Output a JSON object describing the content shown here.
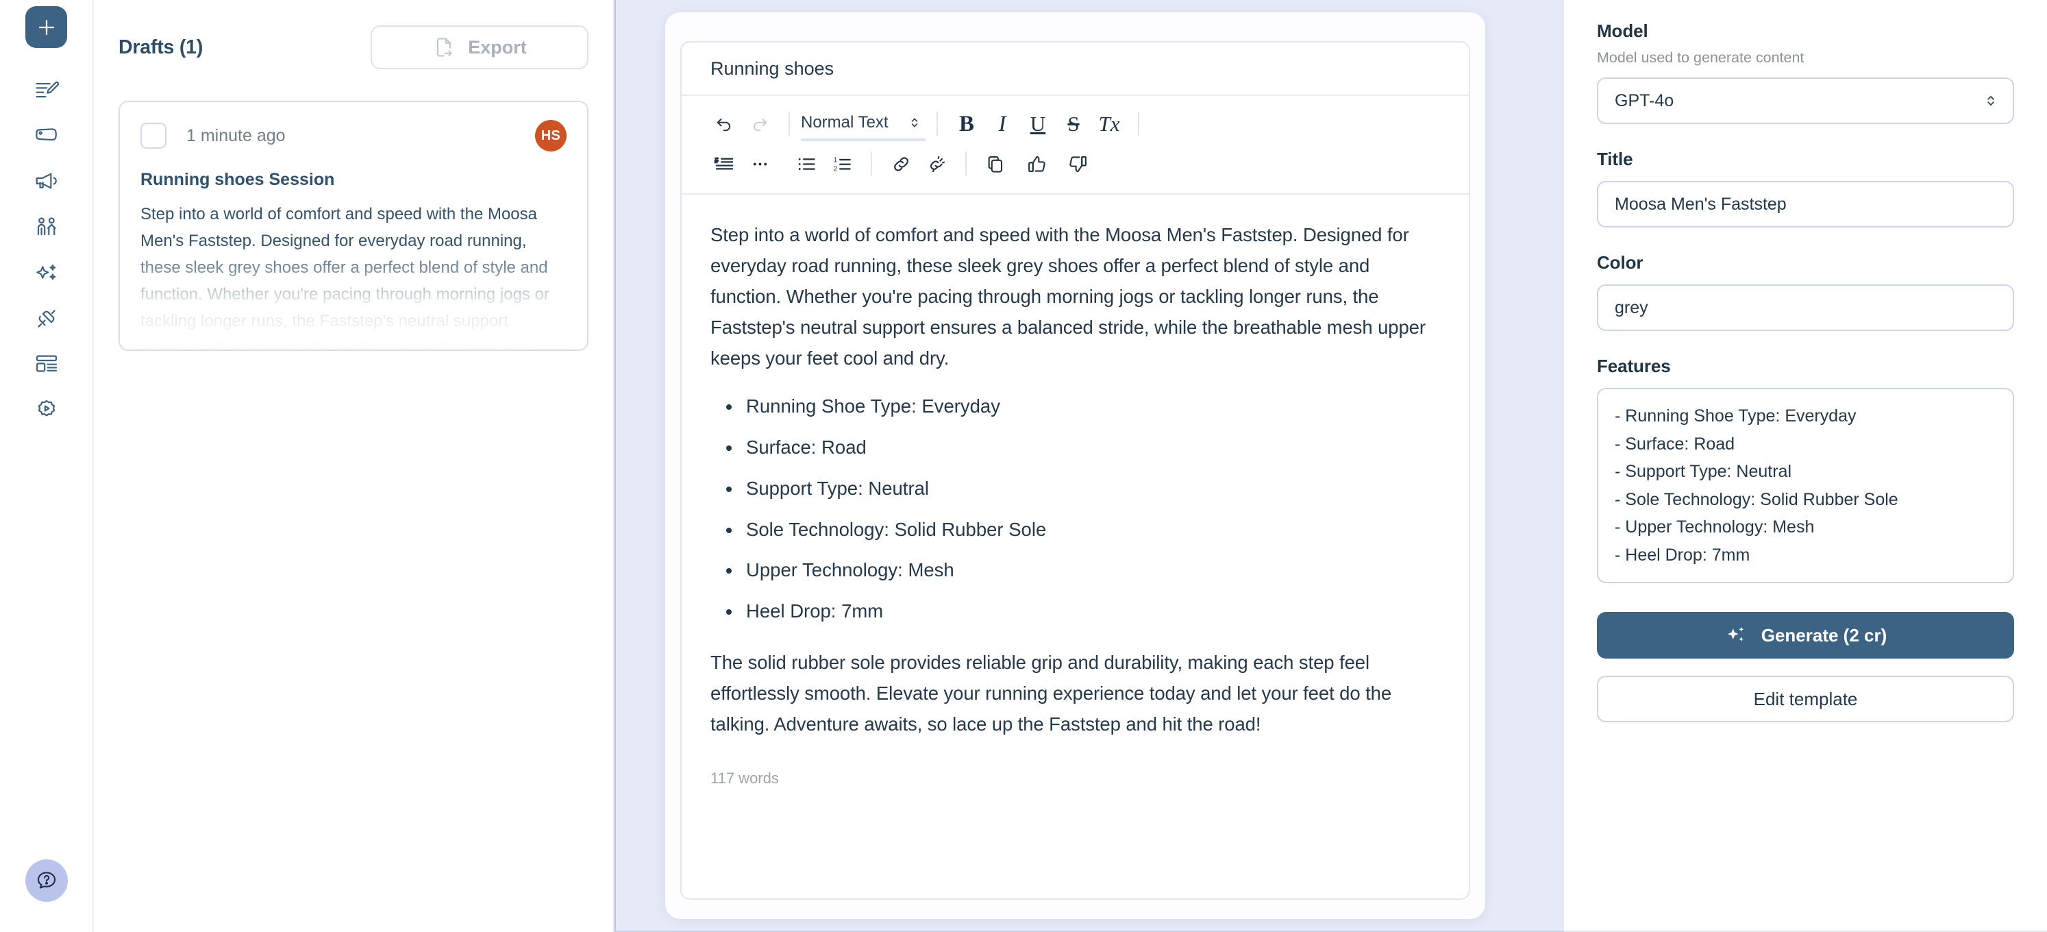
{
  "rail": {
    "add_button": "new",
    "items": [
      {
        "icon": "document-edit-icon",
        "name": "sidebar-item-drafts"
      },
      {
        "icon": "tag-icon",
        "name": "sidebar-item-tags"
      },
      {
        "icon": "megaphone-icon",
        "name": "sidebar-item-campaigns"
      },
      {
        "icon": "people-icon",
        "name": "sidebar-item-audience"
      },
      {
        "icon": "sparkles-icon",
        "name": "sidebar-item-ai"
      },
      {
        "icon": "plug-connect-icon",
        "name": "sidebar-item-integrations"
      },
      {
        "icon": "layout-icon",
        "name": "sidebar-item-templates"
      },
      {
        "icon": "badge-play-icon",
        "name": "sidebar-item-tutorials"
      }
    ],
    "help_icon": "question-bubble-icon"
  },
  "drafts": {
    "title": "Drafts (1)",
    "export_label": "Export",
    "export_icon": "file-export-icon",
    "card": {
      "timestamp": "1 minute ago",
      "avatar_initials": "HS",
      "session_name": "Running shoes Session",
      "preview": "Step into a world of comfort and speed with the Moosa Men's Faststep. Designed for everyday road running, these sleek grey shoes offer a perfect blend of style and function. Whether you're pacing through morning jogs or tackling longer runs, the Faststep's neutral support ensures a balanced stride, while the breathable mesh upper keeps your feet cool and dry. - Running Shoe"
    }
  },
  "editor": {
    "doc_title": "Running shoes",
    "toolbar": {
      "undo_icon": "undo-icon",
      "redo_icon": "redo-icon",
      "style_select": "Normal Text",
      "bold": "B",
      "italic": "I",
      "underline": "U",
      "strikethrough": "S",
      "clear_format": "Tx",
      "quote_icon": "blockquote-icon",
      "divider_icon": "horizontal-rule-icon",
      "bullet_list_icon": "bullet-list-icon",
      "numbered_list_icon": "numbered-list-icon",
      "link_icon": "link-icon",
      "unlink_icon": "unlink-icon",
      "copy_icon": "copy-icon",
      "thumbs_up_icon": "thumbs-up-icon",
      "thumbs_down_icon": "thumbs-down-icon"
    },
    "paragraph_1": "Step into a world of comfort and speed with the Moosa Men's Faststep. Designed for everyday road running, these sleek grey shoes offer a perfect blend of style and function. Whether you're pacing through morning jogs or tackling longer runs, the Faststep's neutral support ensures a balanced stride, while the breathable mesh upper keeps your feet cool and dry.",
    "bullets": [
      "Running Shoe Type: Everyday",
      "Surface: Road",
      "Support Type: Neutral",
      "Sole Technology: Solid Rubber Sole",
      "Upper Technology: Mesh",
      "Heel Drop: 7mm"
    ],
    "paragraph_2": "The solid rubber sole provides reliable grip and durability, making each step feel effortlessly smooth. Elevate your running experience today and let your feet do the talking. Adventure awaits, so lace up the Faststep and hit the road!",
    "word_count": "117 words"
  },
  "settings": {
    "model_label": "Model",
    "model_help": "Model used to generate content",
    "model_value": "GPT-4o",
    "title_label": "Title",
    "title_value": "Moosa Men's Faststep",
    "color_label": "Color",
    "color_value": "grey",
    "features_label": "Features",
    "features_value": "- Running Shoe Type: Everyday\n- Surface: Road\n- Support Type: Neutral\n- Sole Technology: Solid Rubber Sole\n- Upper Technology: Mesh\n- Heel Drop: 7mm",
    "generate_label": "Generate (2 cr)",
    "generate_icon": "sparkles-icon",
    "edit_template_label": "Edit template"
  },
  "colors": {
    "accent": "#3d6384",
    "panel_bg": "#e6e9f7",
    "avatar": "#cf5322",
    "help_bubble": "#b9c3ec",
    "border": "#cdd4f0"
  }
}
